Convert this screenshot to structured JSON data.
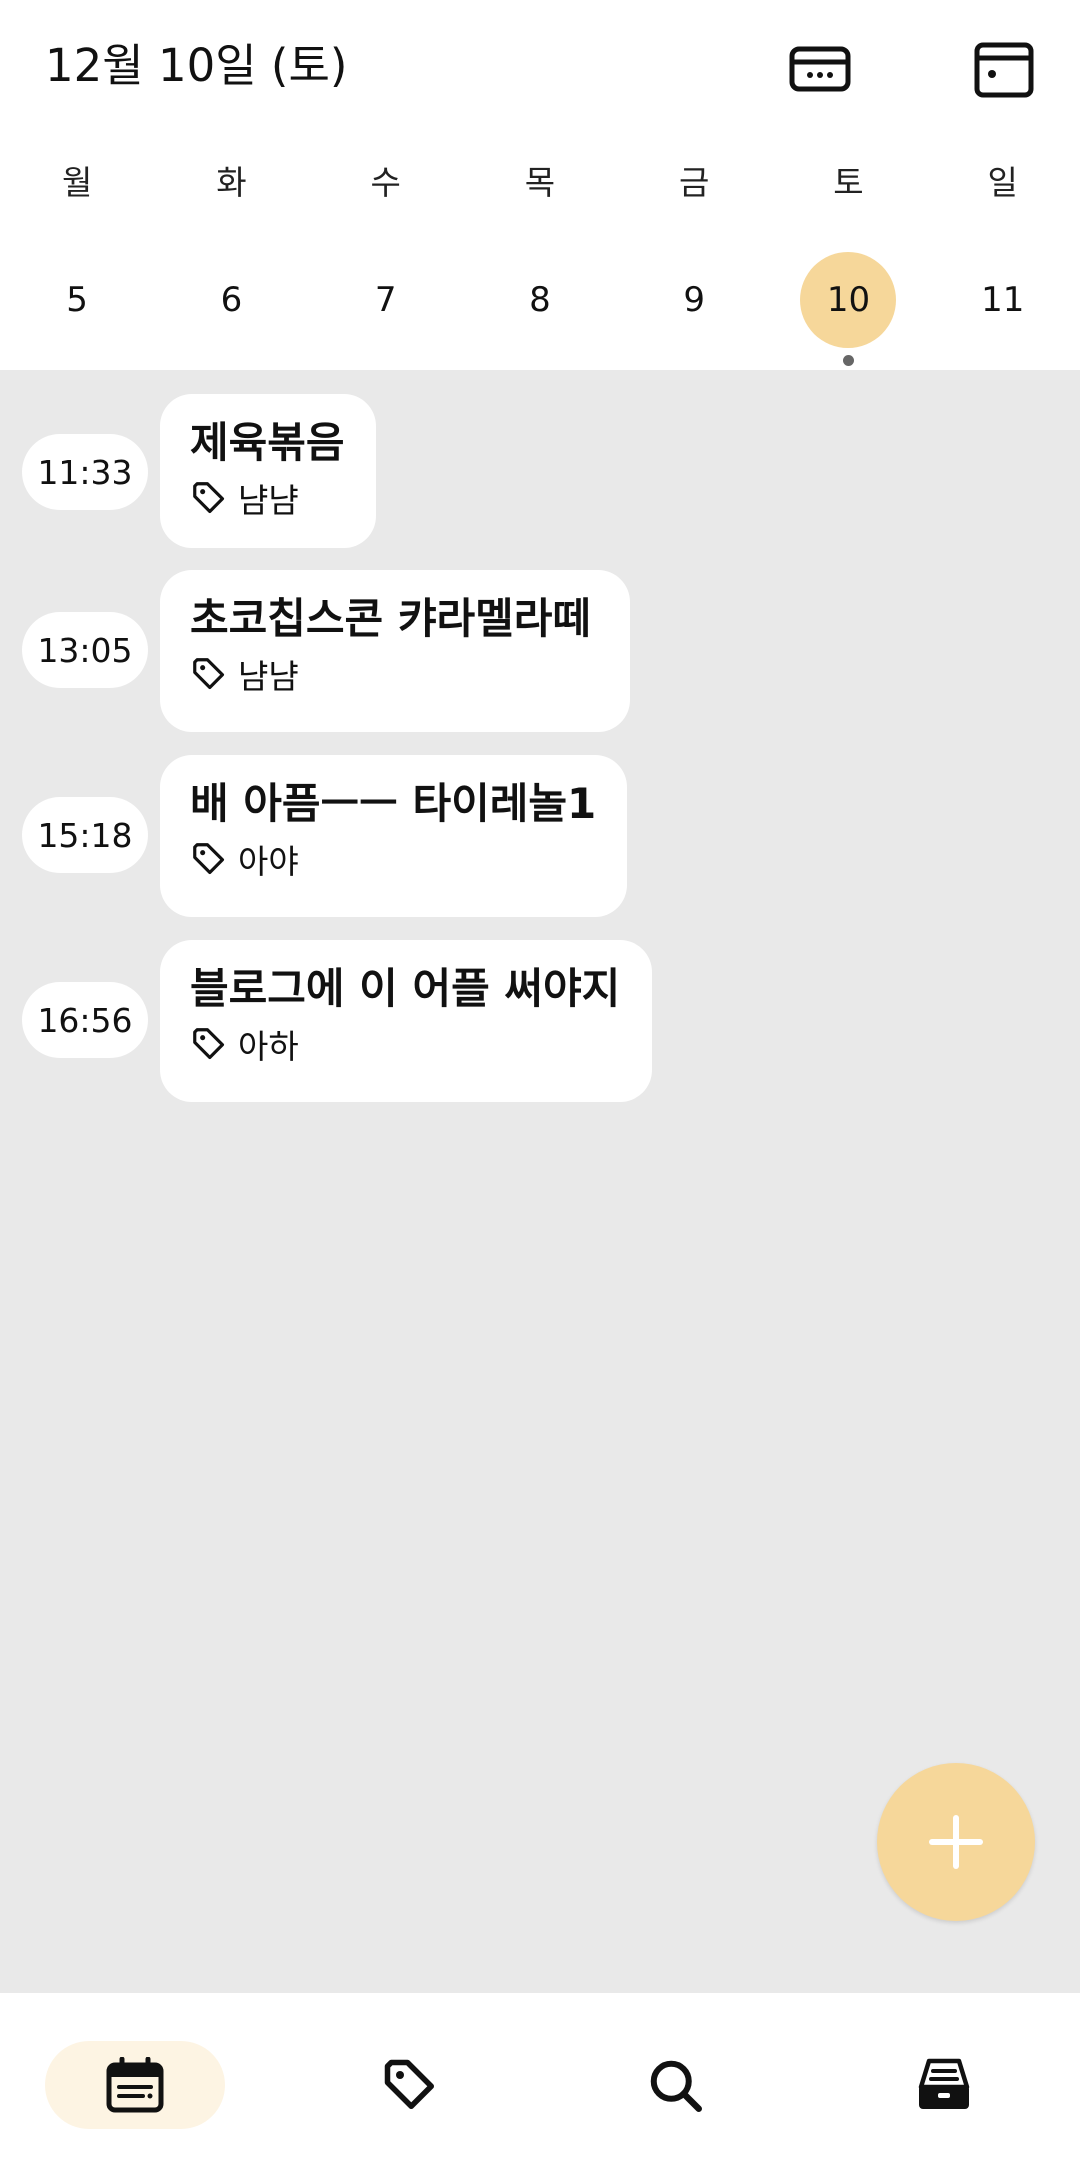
{
  "header": {
    "date_title": "12월 10일 (토)",
    "icons": [
      "card-view-icon",
      "calendar-window-icon"
    ]
  },
  "calendar": {
    "weekdays": [
      "월",
      "화",
      "수",
      "목",
      "금",
      "토",
      "일"
    ],
    "days": [
      "5",
      "6",
      "7",
      "8",
      "9",
      "10",
      "11"
    ],
    "selected_day": "10",
    "has_entries_dot_on": "10"
  },
  "entries": [
    {
      "time": "11:33",
      "title": "제육볶음",
      "tag": "냠냠"
    },
    {
      "time": "13:05",
      "title": "초코칩스콘 캬라멜라떼",
      "tag": "냠냠"
    },
    {
      "time": "15:18",
      "title": "배 아픔ㅡㅡ 타이레놀1",
      "tag": "아야"
    },
    {
      "time": "16:56",
      "title": "블로그에 이 어플 써야지",
      "tag": "아하"
    }
  ],
  "fab": {
    "icon": "plus-icon"
  },
  "nav": {
    "items": [
      "calendar-list-icon",
      "tag-icon",
      "search-icon",
      "archive-icon"
    ],
    "active": "calendar-list-icon"
  },
  "colors": {
    "accent": "#f6d79a",
    "accent_light": "#fdf4e3",
    "background": "#e9e9e9",
    "surface": "#ffffff"
  }
}
